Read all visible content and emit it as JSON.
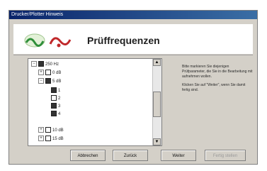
{
  "window": {
    "title": "Drucker/Plotter Hinweis"
  },
  "header": {
    "title": "Prüffrequenzen"
  },
  "tree": {
    "nodes": [
      {
        "label": "250 Hz",
        "expander": "−",
        "checked": true,
        "level": 0
      },
      {
        "label": "0 dB",
        "expander": "+",
        "checked": false,
        "level": 1
      },
      {
        "label": "5 dB",
        "expander": "−",
        "checked": true,
        "level": 1
      },
      {
        "label": "1",
        "expander": "",
        "checked": true,
        "level": 2
      },
      {
        "label": "2",
        "expander": "",
        "checked": false,
        "level": 2
      },
      {
        "label": "3",
        "expander": "",
        "checked": true,
        "level": 2
      },
      {
        "label": "4",
        "expander": "",
        "checked": true,
        "level": 2
      },
      {
        "label": "10 dB",
        "expander": "+",
        "checked": false,
        "level": 1
      },
      {
        "label": "15 dB",
        "expander": "+",
        "checked": false,
        "level": 1
      }
    ]
  },
  "info": {
    "paragraph1": "Bitte markieren Sie diejenigen Prüfparameter, die Sie in die Bearbeitung mit aufnehmen wollen.",
    "paragraph2": "Klicken Sie auf \"Weiter\", wenn Sie damit fertig sind."
  },
  "buttons": {
    "cancel": "Abbrechen",
    "back": "Zurück",
    "next": "Weiter",
    "finish": "Fertig stellen"
  },
  "colors": {
    "titlebar": "#0a246a",
    "face": "#d4d0c8",
    "accent_red": "#c0282a",
    "accent_green": "#2f8f3a"
  }
}
